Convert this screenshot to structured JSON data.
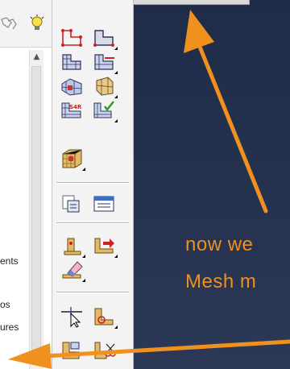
{
  "model_tree": {
    "visible_fragments": [
      "ents",
      "os",
      "ures"
    ]
  },
  "toolbox": {
    "tools": [
      "create-part-icon",
      "create-part-alt-icon",
      "seed-part-icon",
      "seed-edges-icon",
      "mesh-part-icon",
      "mesh-region-icon",
      "assign-element-type-icon",
      "verify-mesh-icon",
      "partition-cell-icon",
      "query-icon",
      "mesh-info-icon",
      "edit-mesh-icon",
      "edit-mesh-alt-icon",
      "erase-mesh-icon",
      "reference-point-icon",
      "datum-icon",
      "delete-icon"
    ],
    "verify_badge": "S4R"
  },
  "viewport": {
    "caption_line1": "now we",
    "caption_line2": "Mesh m"
  },
  "colors": {
    "annotation_orange": "#f0901e",
    "viewport_bg": "#243250"
  }
}
